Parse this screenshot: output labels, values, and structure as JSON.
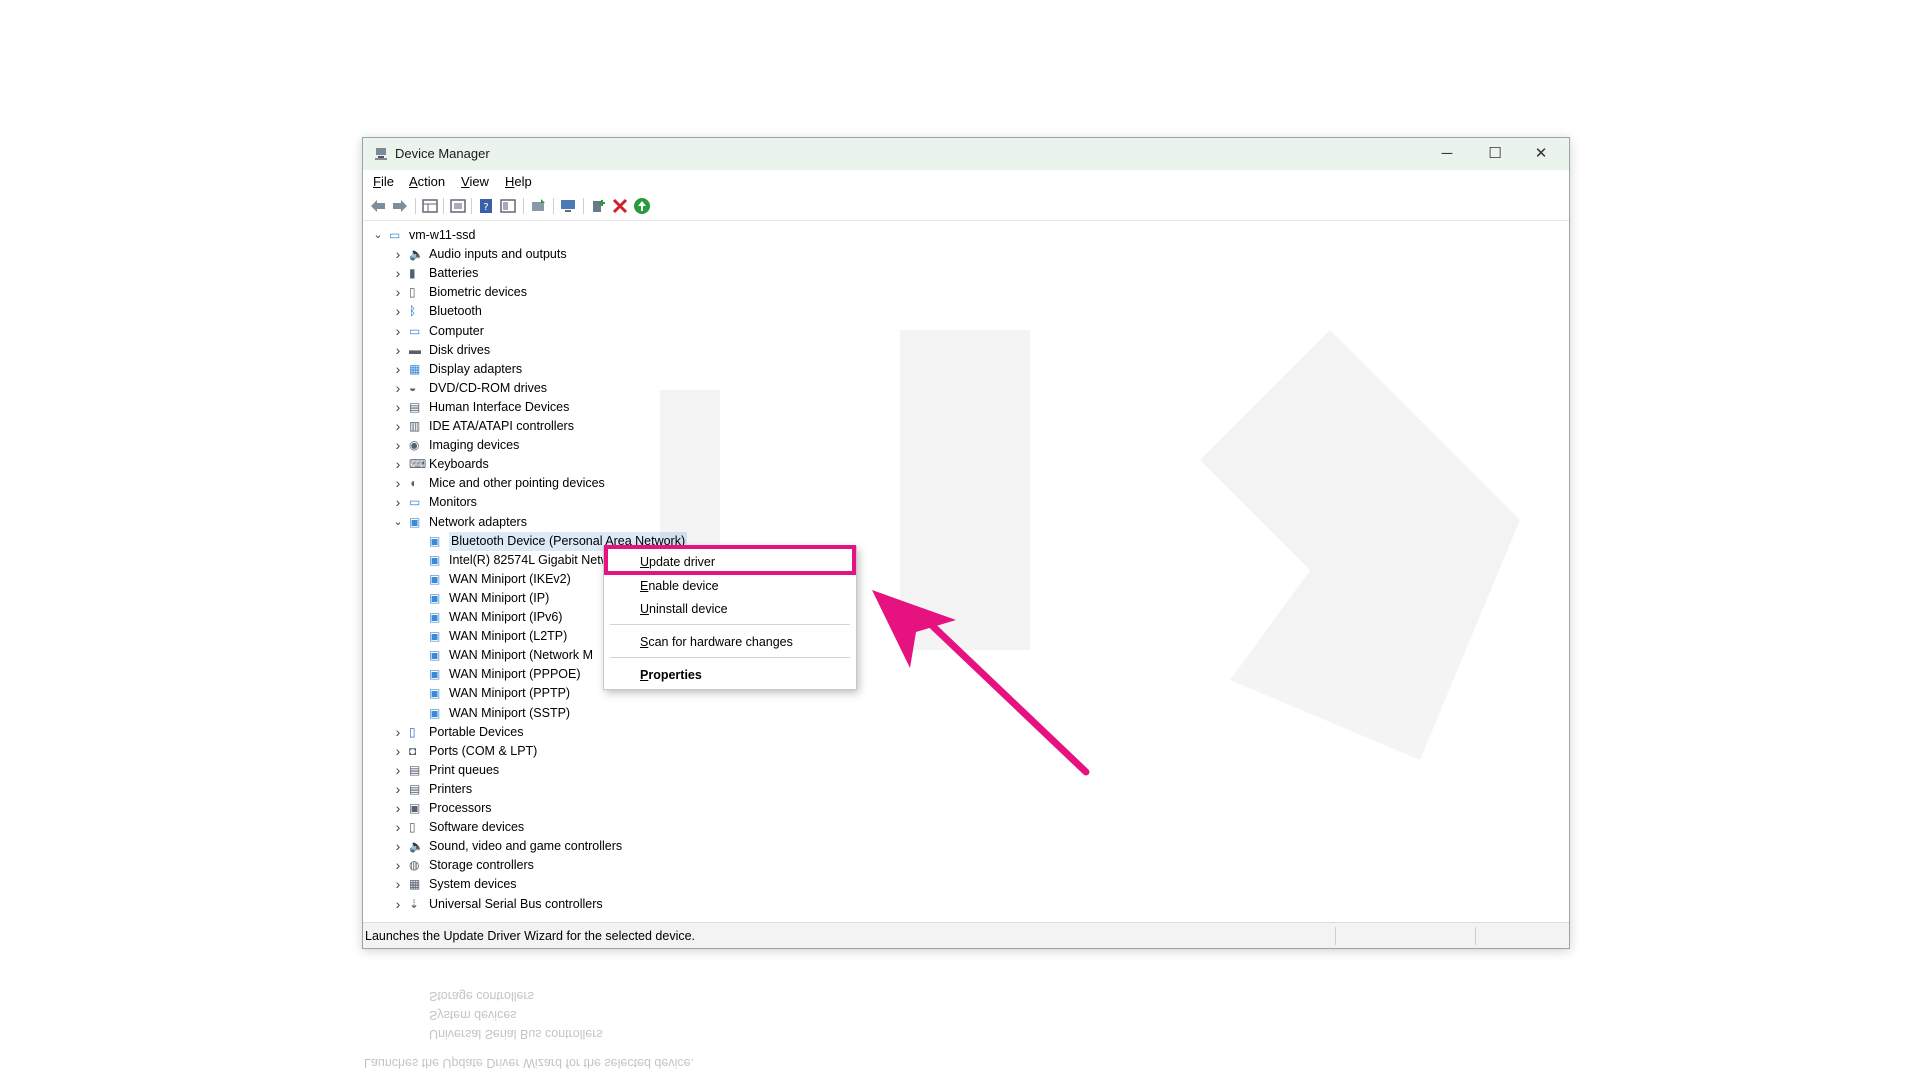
{
  "window": {
    "title": "Device Manager",
    "controls": {
      "minimize": "─",
      "maximize": "☐",
      "close": "✕"
    }
  },
  "menu": [
    "File",
    "Action",
    "View",
    "Help"
  ],
  "toolbar": {
    "icons": [
      "back-arrow-icon",
      "forward-arrow-icon",
      "properties-grid-icon",
      "show-hide-tree-icon",
      "help-icon",
      "view-panel-icon",
      "update-driver-icon",
      "scan-hardware-icon",
      "add-driver-icon",
      "remove-device-icon",
      "enable-device-icon"
    ]
  },
  "tree": {
    "root": "vm-w11-ssd",
    "categories_top": [
      {
        "label": "Audio inputs and outputs",
        "icon": "speaker-icon"
      },
      {
        "label": "Batteries",
        "icon": "battery-icon"
      },
      {
        "label": "Biometric devices",
        "icon": "biometric-icon"
      },
      {
        "label": "Bluetooth",
        "icon": "bluetooth-icon"
      },
      {
        "label": "Computer",
        "icon": "computer-icon"
      },
      {
        "label": "Disk drives",
        "icon": "disk-icon"
      },
      {
        "label": "Display adapters",
        "icon": "display-adapter-icon"
      },
      {
        "label": "DVD/CD-ROM drives",
        "icon": "dvd-icon"
      },
      {
        "label": "Human Interface Devices",
        "icon": "hid-icon"
      },
      {
        "label": "IDE ATA/ATAPI controllers",
        "icon": "ide-icon"
      },
      {
        "label": "Imaging devices",
        "icon": "camera-icon"
      },
      {
        "label": "Keyboards",
        "icon": "keyboard-icon"
      },
      {
        "label": "Mice and other pointing devices",
        "icon": "mouse-icon"
      },
      {
        "label": "Monitors",
        "icon": "monitor-icon"
      },
      {
        "label": "Network adapters",
        "icon": "network-adapter-icon"
      }
    ],
    "network_children": [
      "Bluetooth Device (Personal Area Network)",
      "Intel(R) 82574L Gigabit Netw",
      "WAN Miniport (IKEv2)",
      "WAN Miniport (IP)",
      "WAN Miniport (IPv6)",
      "WAN Miniport (L2TP)",
      "WAN Miniport (Network M",
      "WAN Miniport (PPPOE)",
      "WAN Miniport (PPTP)",
      "WAN Miniport (SSTP)"
    ],
    "categories_bottom": [
      {
        "label": "Portable Devices",
        "icon": "portable-device-icon"
      },
      {
        "label": "Ports (COM & LPT)",
        "icon": "port-icon"
      },
      {
        "label": "Print queues",
        "icon": "print-queue-icon"
      },
      {
        "label": "Printers",
        "icon": "printer-icon"
      },
      {
        "label": "Processors",
        "icon": "processor-icon"
      },
      {
        "label": "Software devices",
        "icon": "software-device-icon"
      },
      {
        "label": "Sound, video and game controllers",
        "icon": "sound-icon"
      },
      {
        "label": "Storage controllers",
        "icon": "storage-icon"
      },
      {
        "label": "System devices",
        "icon": "system-device-icon"
      },
      {
        "label": "Universal Serial Bus controllers",
        "icon": "usb-icon"
      }
    ]
  },
  "context_menu": {
    "update": "Update driver",
    "enable": "Enable device",
    "uninstall": "Uninstall device",
    "scan": "Scan for hardware changes",
    "properties": "Properties"
  },
  "status": {
    "text": "Launches the Update Driver Wizard for the selected device."
  },
  "reflection": {
    "status": "Launches the Update Driver Wizard for the selected device.",
    "rows": [
      "Universal Serial Bus controllers",
      "System devices",
      "Storage controllers"
    ]
  },
  "colors": {
    "highlight": "#e6127f",
    "titlebar": "#eaf4ec",
    "selection": "#dce9f7"
  }
}
